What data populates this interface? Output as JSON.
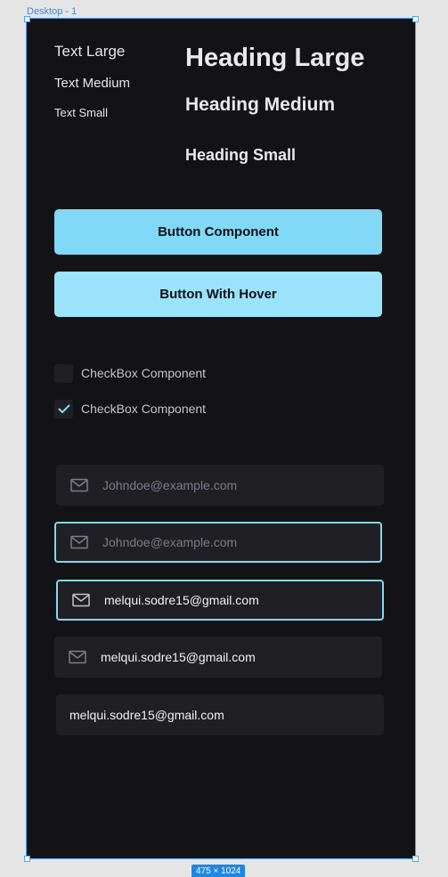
{
  "frame": {
    "label": "Desktop - 1",
    "size_badge": "475 × 1024"
  },
  "typography": {
    "text_large": "Text Large",
    "text_medium": "Text Medium",
    "text_small": "Text Small",
    "heading_large": "Heading Large",
    "heading_medium": "Heading Medium",
    "heading_small": "Heading Small"
  },
  "buttons": {
    "primary_label": "Button Component",
    "hover_label": "Button With Hover"
  },
  "checkboxes": [
    {
      "label": "CheckBox Component",
      "checked": false
    },
    {
      "label": "CheckBox Component",
      "checked": true
    }
  ],
  "inputs": [
    {
      "placeholder": "Johndoe@example.com",
      "value": "",
      "icon": "mail-icon",
      "state": "default"
    },
    {
      "placeholder": "Johndoe@example.com",
      "value": "",
      "icon": "mail-icon",
      "state": "focused"
    },
    {
      "placeholder": "Johndoe@example.com",
      "value": "melqui.sodre15@gmail.com",
      "icon": "mail-icon",
      "state": "focused-filled"
    },
    {
      "placeholder": "Johndoe@example.com",
      "value": "melqui.sodre15@gmail.com",
      "icon": "mail-icon",
      "state": "filled"
    },
    {
      "placeholder": "Johndoe@example.com",
      "value": "melqui.sodre15@gmail.com",
      "icon": "none",
      "state": "filled-no-icon"
    }
  ],
  "colors": {
    "background": "#131315",
    "surface": "#202024",
    "accent": "#81d8f7",
    "accent_hover": "#9ae3fb",
    "text": "#e6e6e8",
    "placeholder": "#7c7c8a",
    "selection": "#4aa3f0"
  }
}
